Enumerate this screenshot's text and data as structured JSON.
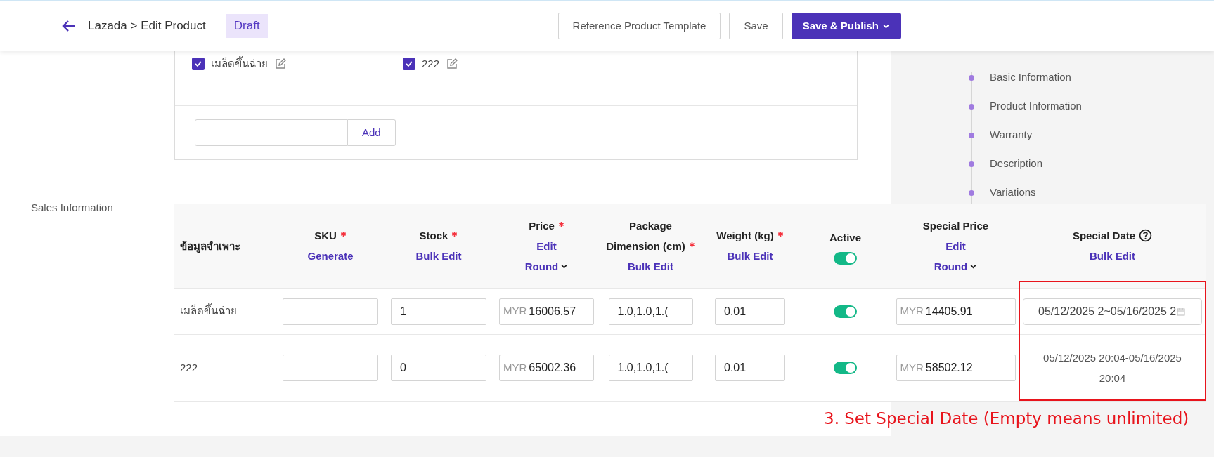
{
  "header": {
    "breadcrumb": "Lazada > Edit Product",
    "status_badge": "Draft",
    "buttons": [
      {
        "label": "Reference Product Template",
        "kind": "outline",
        "menu": false
      },
      {
        "label": "Save",
        "kind": "outline",
        "menu": false
      },
      {
        "label": "Save & Publish",
        "kind": "primary",
        "menu": true
      }
    ]
  },
  "variation_options": {
    "options": [
      {
        "label": "เมล็ดขึ้นฉ่าย",
        "checked": true
      },
      {
        "label": "222",
        "checked": true
      }
    ],
    "add_button": "Add"
  },
  "nav": [
    "Basic Information",
    "Product Information",
    "Warranty",
    "Description",
    "Variations"
  ],
  "section_label": "Sales Information",
  "table": {
    "columns": [
      {
        "title": "ข้อมูลจำเพาะ",
        "required": false,
        "help": false,
        "highlighted": false
      },
      {
        "title": "SKU",
        "required": true,
        "help": false,
        "highlighted": false,
        "actions": [
          {
            "label": "Generate",
            "kind": "link"
          }
        ]
      },
      {
        "title": "Stock",
        "required": true,
        "help": false,
        "highlighted": false,
        "actions": [
          {
            "label": "Bulk Edit",
            "kind": "link"
          }
        ]
      },
      {
        "title": "Price",
        "required": true,
        "help": false,
        "highlighted": false,
        "actions": [
          {
            "label": "Edit",
            "kind": "link"
          },
          {
            "label": "Round",
            "kind": "dropdown"
          }
        ]
      },
      {
        "title": "Package Dimension (cm)",
        "required": true,
        "help": false,
        "highlighted": false,
        "actions": [
          {
            "label": "Bulk Edit",
            "kind": "link"
          }
        ]
      },
      {
        "title": "Weight (kg)",
        "required": true,
        "help": false,
        "highlighted": false,
        "actions": [
          {
            "label": "Bulk Edit",
            "kind": "link"
          }
        ]
      },
      {
        "title": "Active",
        "required": false,
        "help": false,
        "highlighted": false,
        "switch_on": true
      },
      {
        "title": "Special Price",
        "required": false,
        "help": false,
        "highlighted": false,
        "actions": [
          {
            "label": "Edit",
            "kind": "link"
          },
          {
            "label": "Round",
            "kind": "dropdown"
          }
        ]
      },
      {
        "title": "Special Date",
        "required": false,
        "help": true,
        "highlighted": true,
        "actions": [
          {
            "label": "Bulk Edit",
            "kind": "link"
          }
        ]
      }
    ],
    "rows": [
      {
        "cells": [
          {
            "kind": "text",
            "text": "เมล็ดขึ้นฉ่าย"
          },
          {
            "kind": "input"
          },
          {
            "kind": "input",
            "value": "1"
          },
          {
            "kind": "money",
            "currency": "MYR",
            "value": "16006.57"
          },
          {
            "kind": "input",
            "value": "1.0,1.0,1.("
          },
          {
            "kind": "input",
            "value": "0.01"
          },
          {
            "kind": "switch",
            "on": true
          },
          {
            "kind": "money",
            "currency": "MYR",
            "value": "14405.91"
          },
          {
            "kind": "date_range",
            "value": "05/12/2025 2~05/16/2025 2"
          }
        ]
      },
      {
        "cells": [
          {
            "kind": "text",
            "text": "222"
          },
          {
            "kind": "input"
          },
          {
            "kind": "input",
            "value": "0"
          },
          {
            "kind": "money",
            "currency": "MYR",
            "value": "65002.36"
          },
          {
            "kind": "input",
            "value": "1.0,1.0,1.("
          },
          {
            "kind": "input",
            "value": "0.01"
          },
          {
            "kind": "switch",
            "on": true
          },
          {
            "kind": "money",
            "currency": "MYR",
            "value": "58502.12"
          },
          {
            "kind": "date_text",
            "text": "05/12/2025 20:04-05/16/2025 20:04"
          }
        ]
      }
    ]
  },
  "annotation": {
    "text": "3. Set Special Date (Empty means unlimited)"
  }
}
